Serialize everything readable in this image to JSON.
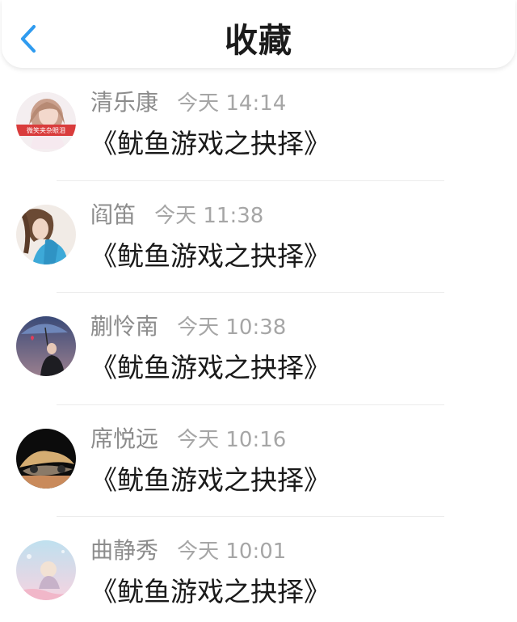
{
  "header": {
    "title": "收藏",
    "back_icon": "chevron-left-icon",
    "accent_color": "#2f9bef"
  },
  "items": [
    {
      "sender": "清乐康",
      "time": "今天 14:14",
      "content": "《鱿鱼游戏之抉择》",
      "avatar_caption": "微笑夹杂眼泪"
    },
    {
      "sender": "阎笛",
      "time": "今天 11:38",
      "content": "《鱿鱼游戏之抉择》"
    },
    {
      "sender": "蒯怜南",
      "time": "今天 10:38",
      "content": "《鱿鱼游戏之抉择》"
    },
    {
      "sender": "席悦远",
      "time": "今天 10:16",
      "content": "《鱿鱼游戏之抉择》"
    },
    {
      "sender": "曲静秀",
      "time": "今天 10:01",
      "content": "《鱿鱼游戏之抉择》"
    }
  ]
}
